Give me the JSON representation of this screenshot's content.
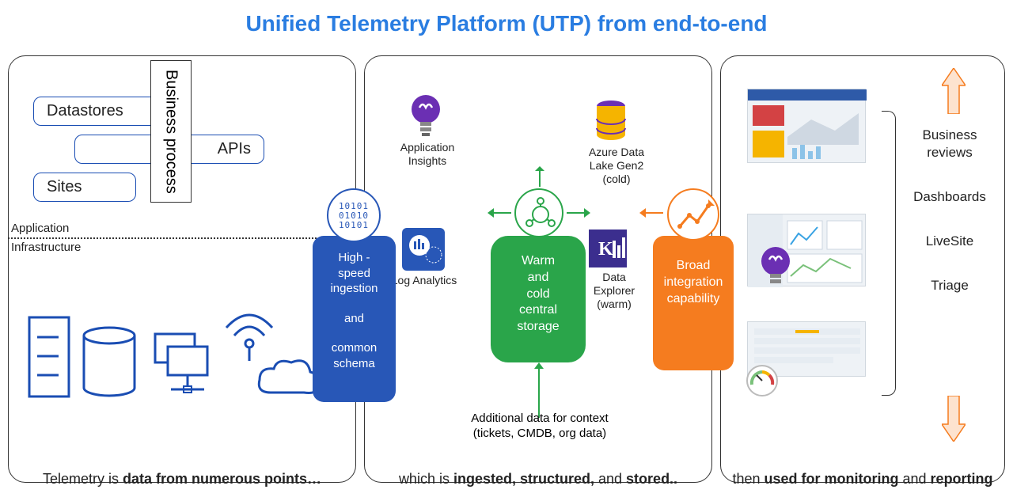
{
  "title": "Unified Telemetry Platform (UTP) from end-to-end",
  "panel1": {
    "vert": "Business process",
    "chips": {
      "datastores": "Datastores",
      "apis": "APIs",
      "sites": "Sites"
    },
    "div_app": "Application",
    "div_infra": "Infrastructure",
    "caption_pre": "Telemetry is ",
    "caption_bold": "data from numerous points…"
  },
  "ingest": {
    "binary": "10101\n01010\n10101",
    "l1": "High -",
    "l2": "speed",
    "l3": "ingestion",
    "l4": "and",
    "l5": "common",
    "l6": "schema"
  },
  "panel2": {
    "ai_label": "Application Insights",
    "la_label": "Log Analytics",
    "adls_label1": "Azure Data",
    "adls_label2": "Lake Gen2",
    "adls_label3": "(cold)",
    "kusto1": "Data",
    "kusto2": "Explorer",
    "kusto3": "(warm)",
    "storage1": "Warm",
    "storage2": "and",
    "storage3": "cold",
    "storage4": "central",
    "storage5": "storage",
    "ctx1": "Additional data for context",
    "ctx2": "(tickets, CMDB, org data)",
    "caption_pre": "which is ",
    "caption_b1": "ingested, structured,",
    "caption_mid": " and ",
    "caption_b2": "stored.."
  },
  "broad": {
    "l1": "Broad",
    "l2": "integration",
    "l3": "capability"
  },
  "panel3": {
    "list": {
      "a": "Business reviews",
      "b": "Dashboards",
      "c": "LiveSite",
      "d": "Triage"
    },
    "caption_pre": "then ",
    "caption_b1": "used for monitoring",
    "caption_mid": " and ",
    "caption_b2": "reporting"
  }
}
